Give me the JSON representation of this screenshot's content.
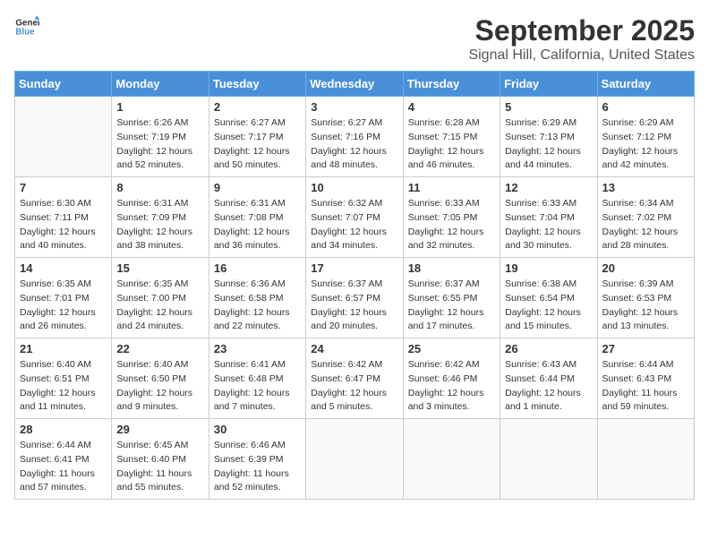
{
  "header": {
    "logo_general": "General",
    "logo_blue": "Blue",
    "month": "September 2025",
    "location": "Signal Hill, California, United States"
  },
  "days_of_week": [
    "Sunday",
    "Monday",
    "Tuesday",
    "Wednesday",
    "Thursday",
    "Friday",
    "Saturday"
  ],
  "weeks": [
    [
      {
        "day": "",
        "info": ""
      },
      {
        "day": "1",
        "info": "Sunrise: 6:26 AM\nSunset: 7:19 PM\nDaylight: 12 hours\nand 52 minutes."
      },
      {
        "day": "2",
        "info": "Sunrise: 6:27 AM\nSunset: 7:17 PM\nDaylight: 12 hours\nand 50 minutes."
      },
      {
        "day": "3",
        "info": "Sunrise: 6:27 AM\nSunset: 7:16 PM\nDaylight: 12 hours\nand 48 minutes."
      },
      {
        "day": "4",
        "info": "Sunrise: 6:28 AM\nSunset: 7:15 PM\nDaylight: 12 hours\nand 46 minutes."
      },
      {
        "day": "5",
        "info": "Sunrise: 6:29 AM\nSunset: 7:13 PM\nDaylight: 12 hours\nand 44 minutes."
      },
      {
        "day": "6",
        "info": "Sunrise: 6:29 AM\nSunset: 7:12 PM\nDaylight: 12 hours\nand 42 minutes."
      }
    ],
    [
      {
        "day": "7",
        "info": "Sunrise: 6:30 AM\nSunset: 7:11 PM\nDaylight: 12 hours\nand 40 minutes."
      },
      {
        "day": "8",
        "info": "Sunrise: 6:31 AM\nSunset: 7:09 PM\nDaylight: 12 hours\nand 38 minutes."
      },
      {
        "day": "9",
        "info": "Sunrise: 6:31 AM\nSunset: 7:08 PM\nDaylight: 12 hours\nand 36 minutes."
      },
      {
        "day": "10",
        "info": "Sunrise: 6:32 AM\nSunset: 7:07 PM\nDaylight: 12 hours\nand 34 minutes."
      },
      {
        "day": "11",
        "info": "Sunrise: 6:33 AM\nSunset: 7:05 PM\nDaylight: 12 hours\nand 32 minutes."
      },
      {
        "day": "12",
        "info": "Sunrise: 6:33 AM\nSunset: 7:04 PM\nDaylight: 12 hours\nand 30 minutes."
      },
      {
        "day": "13",
        "info": "Sunrise: 6:34 AM\nSunset: 7:02 PM\nDaylight: 12 hours\nand 28 minutes."
      }
    ],
    [
      {
        "day": "14",
        "info": "Sunrise: 6:35 AM\nSunset: 7:01 PM\nDaylight: 12 hours\nand 26 minutes."
      },
      {
        "day": "15",
        "info": "Sunrise: 6:35 AM\nSunset: 7:00 PM\nDaylight: 12 hours\nand 24 minutes."
      },
      {
        "day": "16",
        "info": "Sunrise: 6:36 AM\nSunset: 6:58 PM\nDaylight: 12 hours\nand 22 minutes."
      },
      {
        "day": "17",
        "info": "Sunrise: 6:37 AM\nSunset: 6:57 PM\nDaylight: 12 hours\nand 20 minutes."
      },
      {
        "day": "18",
        "info": "Sunrise: 6:37 AM\nSunset: 6:55 PM\nDaylight: 12 hours\nand 17 minutes."
      },
      {
        "day": "19",
        "info": "Sunrise: 6:38 AM\nSunset: 6:54 PM\nDaylight: 12 hours\nand 15 minutes."
      },
      {
        "day": "20",
        "info": "Sunrise: 6:39 AM\nSunset: 6:53 PM\nDaylight: 12 hours\nand 13 minutes."
      }
    ],
    [
      {
        "day": "21",
        "info": "Sunrise: 6:40 AM\nSunset: 6:51 PM\nDaylight: 12 hours\nand 11 minutes."
      },
      {
        "day": "22",
        "info": "Sunrise: 6:40 AM\nSunset: 6:50 PM\nDaylight: 12 hours\nand 9 minutes."
      },
      {
        "day": "23",
        "info": "Sunrise: 6:41 AM\nSunset: 6:48 PM\nDaylight: 12 hours\nand 7 minutes."
      },
      {
        "day": "24",
        "info": "Sunrise: 6:42 AM\nSunset: 6:47 PM\nDaylight: 12 hours\nand 5 minutes."
      },
      {
        "day": "25",
        "info": "Sunrise: 6:42 AM\nSunset: 6:46 PM\nDaylight: 12 hours\nand 3 minutes."
      },
      {
        "day": "26",
        "info": "Sunrise: 6:43 AM\nSunset: 6:44 PM\nDaylight: 12 hours\nand 1 minute."
      },
      {
        "day": "27",
        "info": "Sunrise: 6:44 AM\nSunset: 6:43 PM\nDaylight: 11 hours\nand 59 minutes."
      }
    ],
    [
      {
        "day": "28",
        "info": "Sunrise: 6:44 AM\nSunset: 6:41 PM\nDaylight: 11 hours\nand 57 minutes."
      },
      {
        "day": "29",
        "info": "Sunrise: 6:45 AM\nSunset: 6:40 PM\nDaylight: 11 hours\nand 55 minutes."
      },
      {
        "day": "30",
        "info": "Sunrise: 6:46 AM\nSunset: 6:39 PM\nDaylight: 11 hours\nand 52 minutes."
      },
      {
        "day": "",
        "info": ""
      },
      {
        "day": "",
        "info": ""
      },
      {
        "day": "",
        "info": ""
      },
      {
        "day": "",
        "info": ""
      }
    ]
  ]
}
